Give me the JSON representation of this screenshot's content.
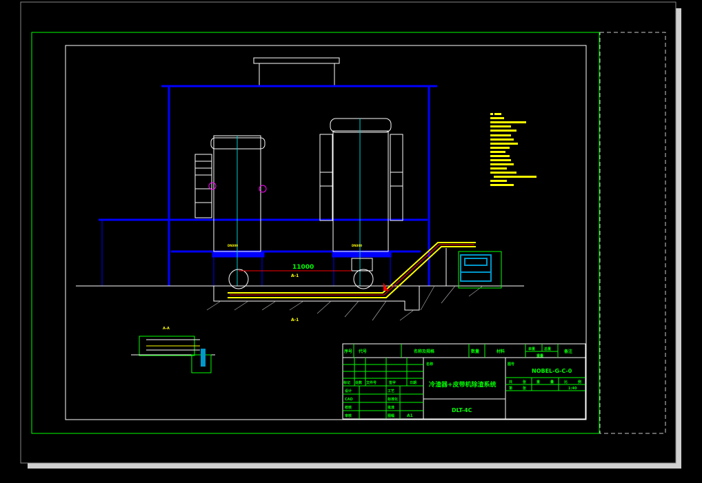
{
  "colors": {
    "background": "#000000",
    "frame": "#00ff00",
    "structure": "#0000ff",
    "equipment": "#ffffff",
    "conveyor": "#ffff00",
    "accent": "#ff0000",
    "truck": "#0099cc",
    "paper_shadow": "#d0d0d0"
  },
  "drawing": {
    "dimension_label": "11000",
    "section_marker": "A-1",
    "detail_label": "A-A",
    "hopper_label_left": "DN300",
    "hopper_label_right": "DN300"
  },
  "title_block": {
    "header": [
      "序号",
      "代号",
      "名称及规格",
      "数量",
      "材料",
      "单重",
      "总重",
      "备注"
    ],
    "weight_header": "重量",
    "revision_header": [
      "标记",
      "处数",
      "文件号",
      "签字",
      "日期"
    ],
    "roles_left": [
      "设计",
      "CAD",
      "校核",
      "审核"
    ],
    "roles_right": [
      "工艺",
      "标准化",
      "批准",
      "图幅"
    ],
    "sheet_size": "A1",
    "company_label": "名称",
    "drawing_title": "冷渣器+皮带机除渣系统",
    "model": "DLT-4C",
    "drawing_no_label": "图号",
    "drawing_no": "NOBEL-G-C-0",
    "sheet_row1": [
      "共",
      "张",
      "重",
      "量",
      "比",
      "例"
    ],
    "sheet_row2": [
      "第",
      "张",
      "",
      "1:40"
    ]
  }
}
